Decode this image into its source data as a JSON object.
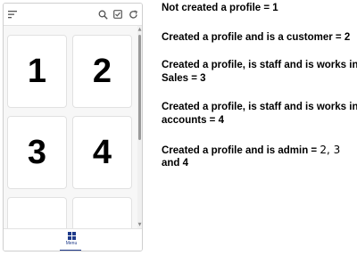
{
  "app": {
    "toolbar_icons": [
      "sort-icon",
      "search-icon",
      "checkbox-icon",
      "refresh-icon"
    ],
    "tiles": [
      "1",
      "2",
      "3",
      "4",
      "",
      ""
    ],
    "scrollbar": {
      "up_arrow": "▲",
      "down_arrow": "▼"
    },
    "bottom_nav": {
      "menu_label": "Menu",
      "menu_icon": "grid-icon"
    },
    "accent_color": "#1e3a8a"
  },
  "notes": {
    "line1": "Not created a profile = 1",
    "line2": "Created a profile and is a customer = 2",
    "line3a": "Created a profile, is staff and is works in",
    "line3b": "Sales = 3",
    "line4a": "Created a profile, is staff and is works in",
    "line4b": "accounts = 4",
    "line5a": "Created a profile and is admin = ",
    "line5_handwritten": "2, 3",
    "line5b": "and 4"
  }
}
